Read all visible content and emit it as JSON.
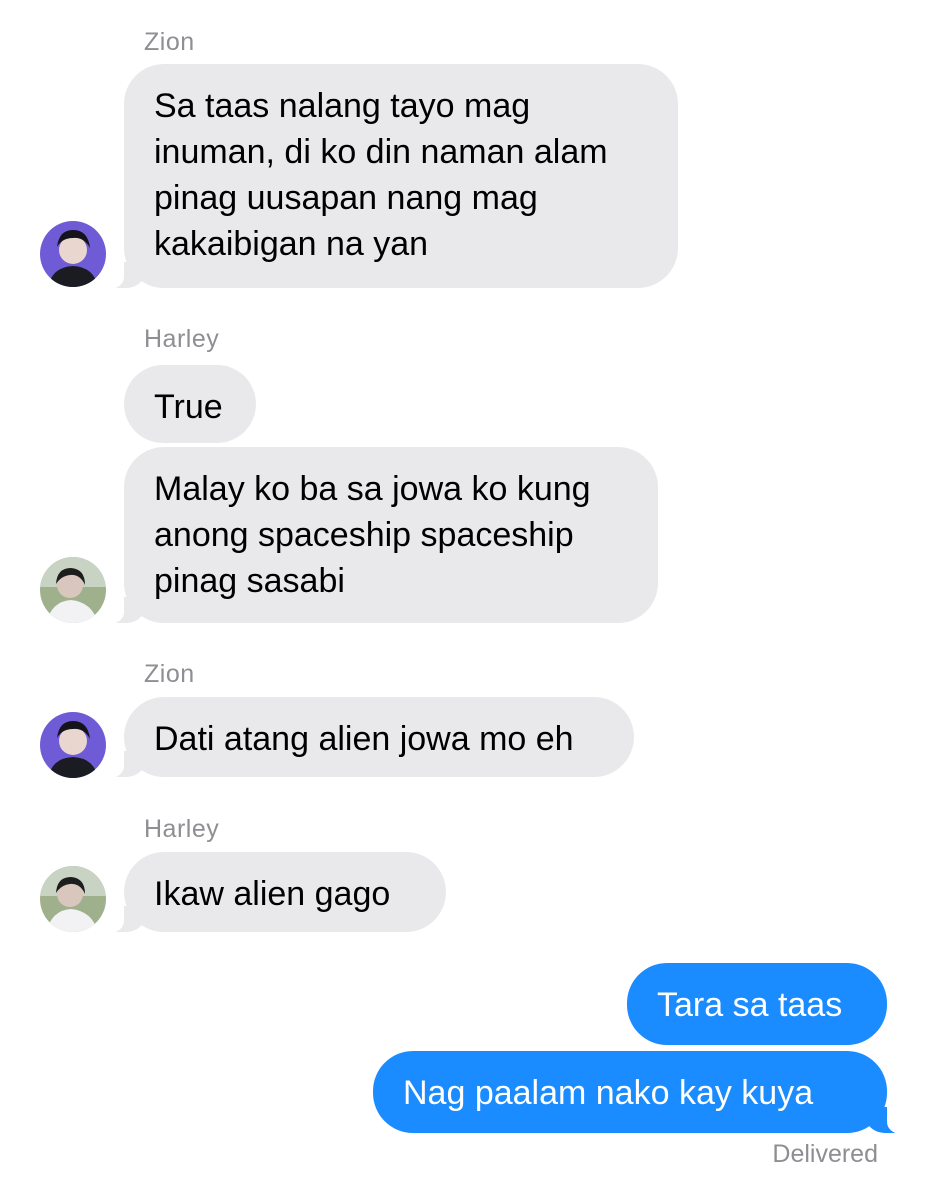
{
  "conversation": {
    "blocks": [
      {
        "sender": "Zion",
        "messages": [
          "Sa taas nalang tayo mag\ninuman, di ko din naman alam\npinag uusapan nang mag\nkakaibigan na yan"
        ]
      },
      {
        "sender": "Harley",
        "messages": [
          "True",
          "Malay ko ba sa jowa ko kung\nanong spaceship spaceship\npinag sasabi"
        ]
      },
      {
        "sender": "Zion",
        "messages": [
          "Dati atang alien jowa mo eh"
        ]
      },
      {
        "sender": "Harley",
        "messages": [
          "Ikaw alien gago"
        ]
      }
    ],
    "outgoing": [
      "Tara sa taas",
      "Nag paalam nako kay kuya"
    ],
    "status": "Delivered"
  },
  "colors": {
    "incoming_bubble": "#e9e9eb",
    "outgoing_bubble": "#1a8cff",
    "sender_label": "#8e8e93"
  },
  "avatars": {
    "zion": "avatar-purple-background-person",
    "harley": "avatar-outdoor-person"
  }
}
